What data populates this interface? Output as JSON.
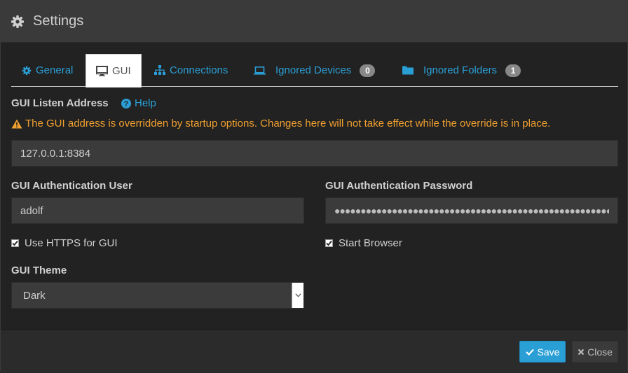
{
  "header": {
    "title": "Settings",
    "icon": "gear-icon"
  },
  "tabs": [
    {
      "label": "General",
      "icon": "gear-icon"
    },
    {
      "label": "GUI",
      "icon": "desktop-icon"
    },
    {
      "label": "Connections",
      "icon": "sitemap-icon"
    },
    {
      "label": "Ignored Devices",
      "icon": "laptop-icon",
      "badge": "0"
    },
    {
      "label": "Ignored Folders",
      "icon": "folder-icon",
      "badge": "1"
    }
  ],
  "gui": {
    "listen_label": "GUI Listen Address",
    "help_label": "Help",
    "warning": "The GUI address is overridden by startup options. Changes here will not take effect while the override is in place.",
    "listen_value": "127.0.0.1:8384",
    "auth_user_label": "GUI Authentication User",
    "auth_user_value": "adolf",
    "auth_password_label": "GUI Authentication Password",
    "auth_password_value": "●●●●●●●●●●●●●●●●●●●●●●●●●●●●●●●●●●●●●●●●●●●●●●●●●●●●●●●●●●●●",
    "https_label": "Use HTTPS for GUI",
    "https_checked": true,
    "browser_label": "Start Browser",
    "browser_checked": true,
    "theme_label": "GUI Theme",
    "theme_value": "Dark"
  },
  "footer": {
    "save_label": "Save",
    "close_label": "Close"
  },
  "colors": {
    "accent": "#2a9fd6",
    "warning": "#f0a030",
    "background": "#222222"
  }
}
